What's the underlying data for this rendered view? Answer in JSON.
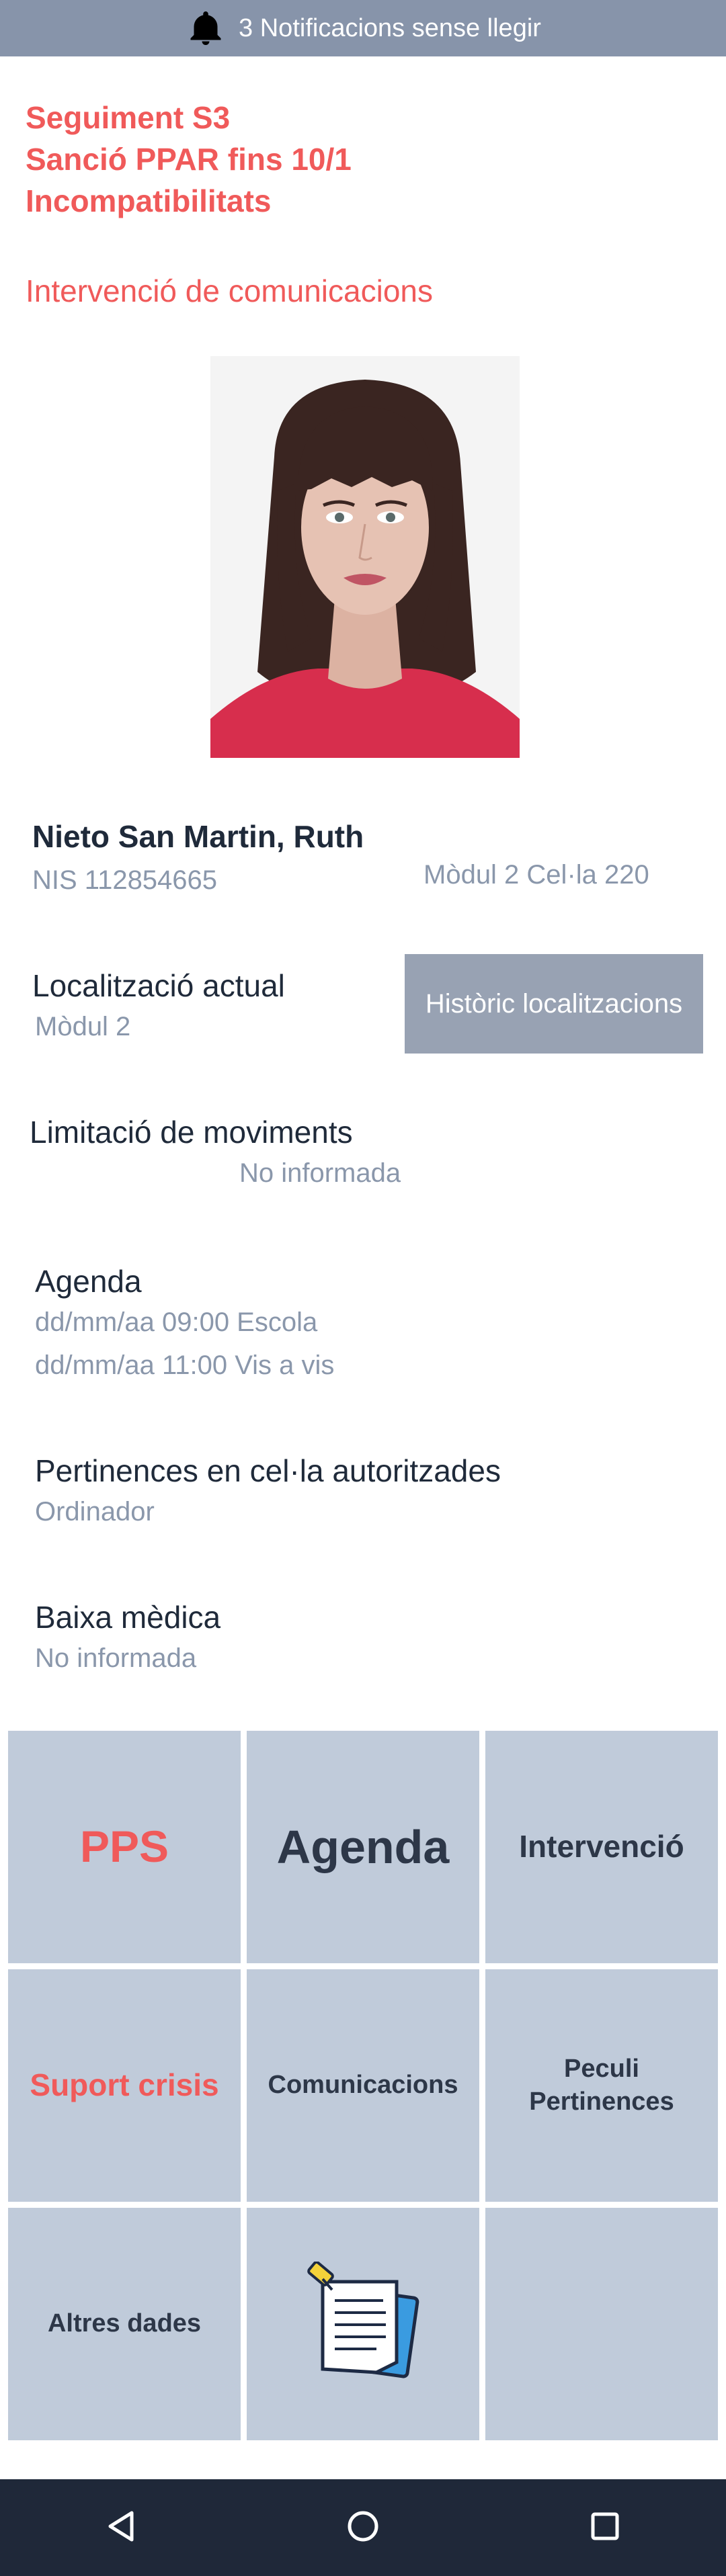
{
  "notifications": {
    "text": "3 Notificacions sense llegir",
    "icon": "bell-icon"
  },
  "alerts": {
    "lines": [
      "Seguiment S3",
      "Sanció PPAR fins 10/1",
      "Incompatibilitats"
    ],
    "intervention": "Intervenció de comunicacions"
  },
  "profile": {
    "photo_alt": "Fotografia de la persona interna",
    "name": "Nieto San Martin, Ruth",
    "nis": "NIS 112854665",
    "cell": "Mòdul 2 Cel·la 220"
  },
  "location": {
    "title": "Localització actual",
    "value": "Mòdul 2",
    "history_button": "Històric localitzacions"
  },
  "movement": {
    "title": "Limitació de moviments",
    "value": "No informada"
  },
  "agenda": {
    "title": "Agenda",
    "items": [
      "dd/mm/aa 09:00 Escola",
      "dd/mm/aa 11:00 Vis a vis"
    ]
  },
  "belongings": {
    "title": "Pertinences en cel·la autoritzades",
    "value": "Ordinador"
  },
  "medical": {
    "title": "Baixa mèdica",
    "value": "No informada"
  },
  "tiles": [
    {
      "label": "PPS",
      "color": "#f05a5a"
    },
    {
      "label": "Agenda",
      "color": "#2d3748"
    },
    {
      "label": "Intervenció",
      "color": "#2d3748"
    },
    {
      "label": "Suport crisis",
      "color": "#f05a5a"
    },
    {
      "label": "Comunicacions",
      "color": "#2d3748"
    },
    {
      "label": "Peculi\nPertinences",
      "color": "#2d3748"
    },
    {
      "label": "Altres dades",
      "color": "#2d3748"
    },
    {
      "icon": "notes-icon"
    },
    {
      "label": ""
    }
  ],
  "colors": {
    "accent_red": "#f05a5a",
    "topbar": "#8794aa",
    "tile_bg": "#c0cbda",
    "navbar": "#1f2839"
  }
}
